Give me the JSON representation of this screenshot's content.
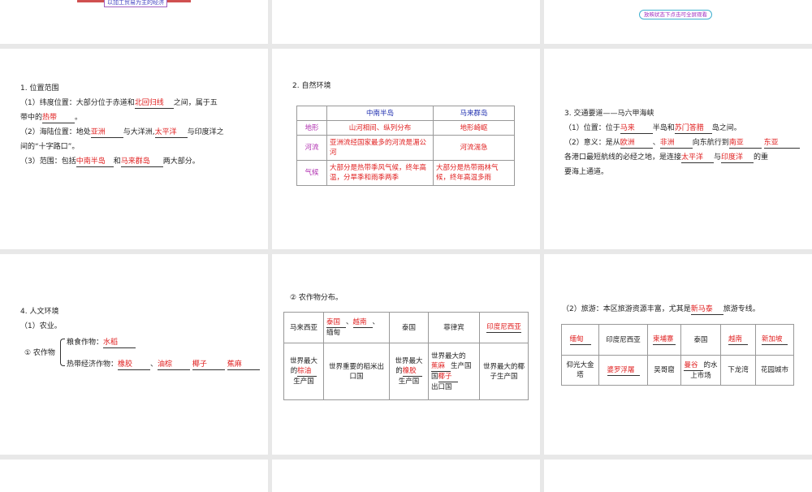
{
  "s1": {
    "box": "以加工贸易为主的经济"
  },
  "s3": {
    "button": "放映状态下点击可全屏观看"
  },
  "p1": {
    "title": "1. 位置范围",
    "l1a": "（1）纬度位置：大部分位于赤道和",
    "a1": "北回归线",
    "l1b": "之间，属于五",
    "l2a": "带中的",
    "a2": "热带",
    "l2b": "。",
    "l3a": "（2）海陆位置：地处",
    "a3": "亚洲",
    "l3b": "与大洋洲,",
    "a4": "太平洋",
    "l3c": "与印度洋之",
    "l4": "间的“十字路口”。",
    "l5a": "（3）范围：包括",
    "a5": "中南半岛",
    "l5b": "和",
    "a6": "马来群岛",
    "l5c": "两大部分。"
  },
  "p2": {
    "title": "2. 自然环境",
    "headers": [
      "",
      "中南半岛",
      "马来群岛"
    ],
    "rows": [
      [
        "地形",
        "山河相间、纵列分布",
        "地形崎岖"
      ],
      [
        "河流",
        "亚洲流经国家最多的河流是湄公河",
        "河流湍急"
      ],
      [
        "气候",
        "大部分是热带季风气候，终年高温，分旱季和雨季两季",
        "大部分是热带雨林气候，终年高温多雨"
      ]
    ]
  },
  "p3": {
    "title": "3. 交通要道——马六甲海峡",
    "l1a": "（1）位置：位于",
    "a1": "马来",
    "l1b": "半岛和",
    "a2": "苏门答腊",
    "l1c": "岛之间。",
    "l2a": "（2）意义：是从",
    "a3": "欧洲",
    "l2b": "、",
    "a4": "非洲",
    "l2c": "向东航行到",
    "a5": "南亚",
    "a6": "东亚",
    "l3a": "各港口最短航线的必经之地，是连接",
    "a7": "太平洋",
    "l3b": "与",
    "a8": "印度洋",
    "l3c": "的重",
    "l4": "要海上通道。"
  },
  "p4": {
    "title": "4. 人文环境",
    "sub": "（1）农业。",
    "crops": "① 农作物",
    "food": "粮食作物：",
    "a1": "水稻",
    "cash": "热带经济作物：",
    "a2": "橡胶",
    "a3": "油棕",
    "a4": "椰子",
    "a5": "蕉麻",
    "sep": "、"
  },
  "p5": {
    "title": "② 农作物分布。",
    "r1": {
      "c1": "马来西亚",
      "c2a": "泰国",
      "c2b": "越南",
      "c2c": "缅甸",
      "c3": "泰国",
      "c4": "菲律宾",
      "c5": "印度尼西亚"
    },
    "r2": {
      "c1a": "世界最大的",
      "c1b": "棕油",
      "c1c": "生产国",
      "c2": "世界重要的稻米出口国",
      "c3a": "世界最大的",
      "c3b": "橡胶",
      "c3c": "生产国",
      "c4a": "世界最大的",
      "c4b": "蕉麻",
      "c4c": "生产国",
      "c4d": "椰子",
      "c4e": "出口国",
      "c5": "世界最大的椰子生产国"
    }
  },
  "p6": {
    "l1a": "（2）旅游：本区旅游资源丰富，尤其是",
    "a1": "新马泰",
    "l1b": "旅游专线。",
    "r1": [
      "缅甸",
      "印度尼西亚",
      "柬埔寨",
      "泰国",
      "越南",
      "新加坡"
    ],
    "r2": {
      "c1": "仰光大金塔",
      "c2": "婆罗浮屠",
      "c3": "吴哥窟",
      "c4a": "曼谷",
      "c4b": "的水上市场",
      "c5": "下龙湾",
      "c6": "花园城市"
    }
  }
}
